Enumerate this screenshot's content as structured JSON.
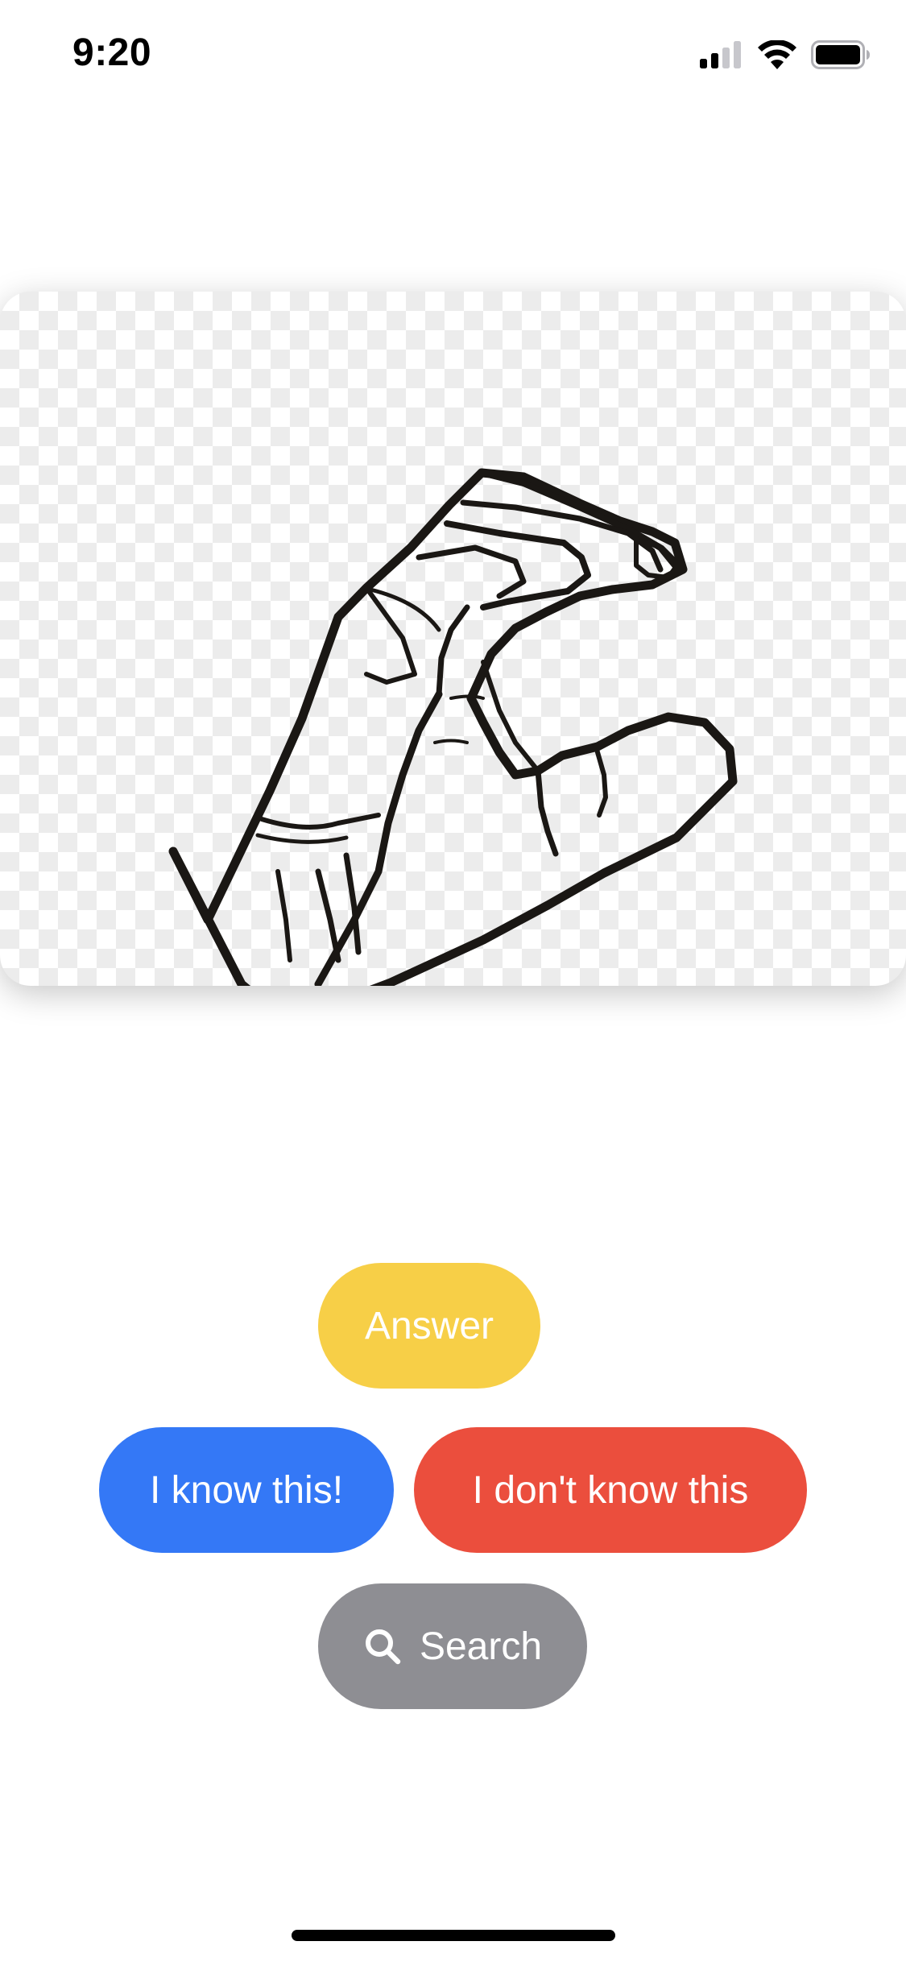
{
  "status_bar": {
    "time": "9:20",
    "icons": [
      "cellular-signal-icon",
      "wifi-icon",
      "battery-icon"
    ]
  },
  "card": {
    "image": "asl-hand-sign-c-drawing"
  },
  "buttons": {
    "answer": {
      "label": "Answer",
      "color": "#F7CF47"
    },
    "know": {
      "label": "I know this!",
      "color": "#3478F6"
    },
    "dont_know": {
      "label": "I don't know this",
      "color": "#EB4E3D"
    },
    "search": {
      "label": "Search",
      "icon": "search-icon",
      "color": "#8E8E93"
    }
  }
}
